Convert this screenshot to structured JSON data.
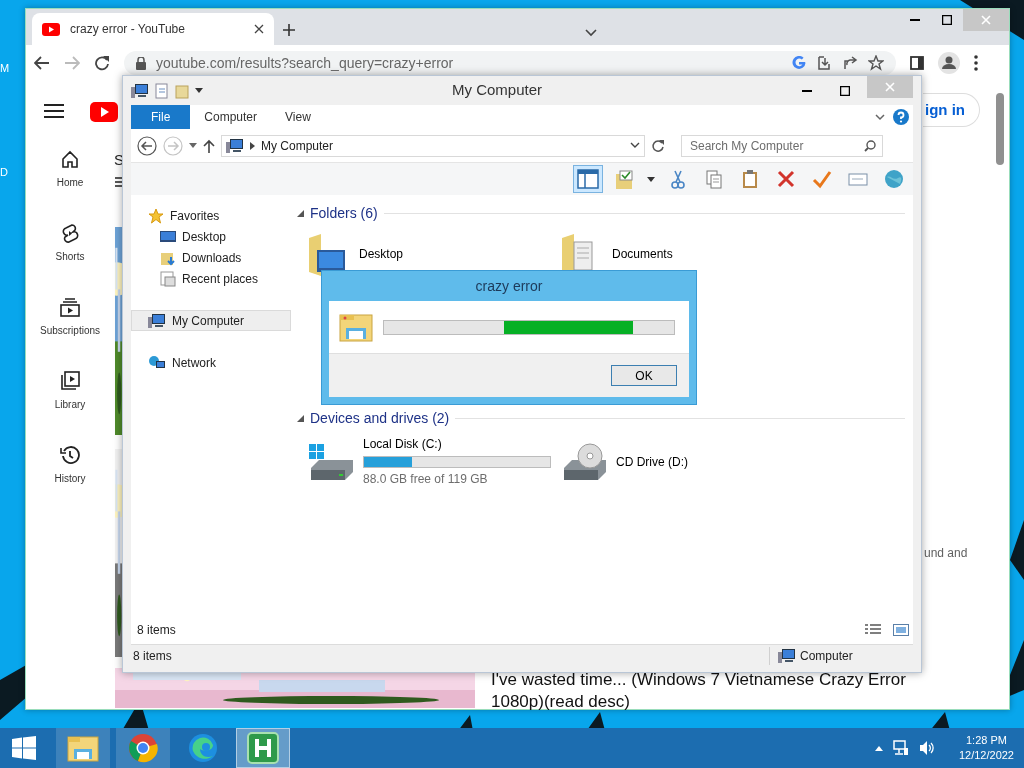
{
  "desktop": {
    "edge_labels": [
      "M",
      "D"
    ]
  },
  "browser": {
    "tab": {
      "title": "crazy error - YouTube",
      "selected": true
    },
    "url": "youtube.com/results?search_query=crazy+error",
    "forward_disabled": true,
    "guide": [
      {
        "label": "Home"
      },
      {
        "label": "Shorts"
      },
      {
        "label": "Subscriptions"
      },
      {
        "label": "Library"
      },
      {
        "label": "History"
      }
    ],
    "partial_heading": "S",
    "sign_in": "ign in",
    "snippet": "und and",
    "video_title": "I've wasted time... (Windows 7 Vietnamese Crazy Error 1080p)(read desc)"
  },
  "explorer": {
    "title": "My Computer",
    "ribbon_tabs": [
      {
        "label": "File",
        "selected": true
      },
      {
        "label": "Computer",
        "selected": false
      },
      {
        "label": "View",
        "selected": false
      }
    ],
    "forward_disabled": true,
    "address": "My Computer",
    "search": {
      "placeholder": "Search My Computer"
    },
    "preview_pane_on": true,
    "nav": [
      {
        "label": "Favorites",
        "selected": false,
        "children": [
          {
            "label": "Desktop",
            "selected": false
          },
          {
            "label": "Downloads",
            "selected": false
          },
          {
            "label": "Recent places",
            "selected": false
          }
        ]
      },
      {
        "label": "My Computer",
        "selected": true
      },
      {
        "label": "Network",
        "selected": false
      }
    ],
    "folders": {
      "title": "Folders (6)",
      "items": [
        {
          "label": "Desktop"
        },
        {
          "label": "Documents"
        }
      ]
    },
    "drives": {
      "title": "Devices and drives (2)",
      "items": [
        {
          "kind": "disk",
          "label": "Local Disk (C:)",
          "level": 0.26,
          "free": "88.0 GB free of 119 GB"
        },
        {
          "kind": "cd",
          "label": "CD Drive (D:)"
        }
      ]
    },
    "footer": "8 items",
    "status": {
      "left": "8 items",
      "right": "Computer"
    }
  },
  "dialog": {
    "title": "crazy error",
    "progress": {
      "level": 0.86
    },
    "button": "OK"
  },
  "taskbar": {
    "apps": [
      {
        "kind": "explorer",
        "running": true,
        "active": false
      },
      {
        "kind": "chrome",
        "running": true,
        "active": false
      },
      {
        "kind": "edge",
        "running": false,
        "active": false
      },
      {
        "kind": "h",
        "running": true,
        "active": true
      }
    ],
    "time": "1:28 PM",
    "date": "12/12/2022"
  }
}
